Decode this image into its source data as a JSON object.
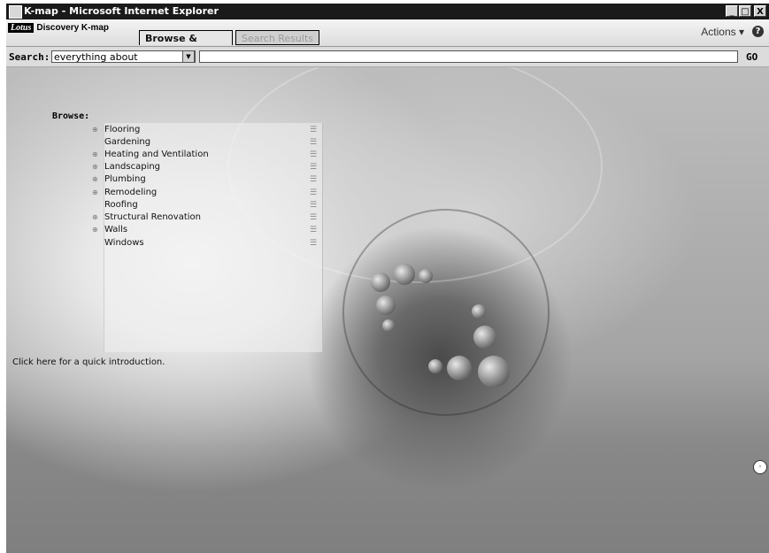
{
  "window": {
    "title": "K-map - Microsoft Internet Explorer",
    "buttons": {
      "minimize": "_",
      "maximize": "□",
      "close": "X"
    }
  },
  "toolbar": {
    "logo_badge": "Lotus",
    "logo_text": "Discovery K-map",
    "tabs": [
      {
        "label": "Browse & Search",
        "active": true
      },
      {
        "label": "Search Results",
        "active": false
      }
    ],
    "actions_label": "Actions",
    "actions_arrow": "▾",
    "help_label": "?"
  },
  "search": {
    "label": "Search:",
    "scope_value": "everything about",
    "scope_arrow": "▼",
    "query_value": "",
    "go_label": "GO"
  },
  "browse": {
    "label": "Browse:",
    "items": [
      {
        "label": "Flooring",
        "expandable": true,
        "expand_glyph": "⊕"
      },
      {
        "label": "Gardening",
        "expandable": false,
        "expand_glyph": ""
      },
      {
        "label": "Heating and Ventilation",
        "expandable": true,
        "expand_glyph": "⊕"
      },
      {
        "label": "Landscaping",
        "expandable": true,
        "expand_glyph": "⊕"
      },
      {
        "label": "Plumbing",
        "expandable": true,
        "expand_glyph": "⊕"
      },
      {
        "label": "Remodeling",
        "expandable": true,
        "expand_glyph": "⊕"
      },
      {
        "label": "Roofing",
        "expandable": false,
        "expand_glyph": ""
      },
      {
        "label": "Structural Renovation",
        "expandable": true,
        "expand_glyph": "⊕"
      },
      {
        "label": "Walls",
        "expandable": true,
        "expand_glyph": "⊕"
      },
      {
        "label": "Windows",
        "expandable": false,
        "expand_glyph": ""
      }
    ],
    "list_glyph": "☰"
  },
  "intro_link": "Click here for a quick introduction.",
  "scroll_glyph": "◦",
  "colors": {
    "titlebar": "#1a1a1a",
    "background": "#808080"
  }
}
